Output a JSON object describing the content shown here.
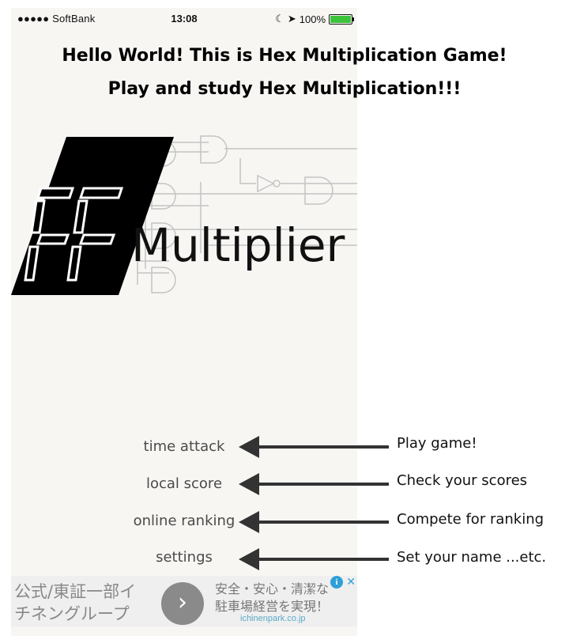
{
  "status_bar": {
    "carrier": "●●●●● SoftBank",
    "time": "13:08",
    "battery": "100%"
  },
  "headline": {
    "line1": "Hello World! This is Hex Multiplication Game!",
    "line2": "Play and study Hex Multiplication!!!"
  },
  "logo": {
    "digits": "FF",
    "word": "Multiplier"
  },
  "menu": [
    {
      "label": "time attack",
      "annotation": "Play game!"
    },
    {
      "label": "local score",
      "annotation": "Check your scores"
    },
    {
      "label": "online ranking",
      "annotation": "Compete for ranking"
    },
    {
      "label": "settings",
      "annotation": "Set your name ...etc."
    }
  ],
  "ad": {
    "left_text_1": "公式/東証一部イ",
    "left_text_2": "チネングループ",
    "right_text_1": "安全・安心・清潔な",
    "right_text_2": "駐車場経営を実現！",
    "url": "ichinenpark.co.jp",
    "button_glyph": "›",
    "info_glyph": "i",
    "close_glyph": "✕"
  },
  "colors": {
    "panel_bg": "#f7f6f3",
    "menu_text": "#4a4a4a",
    "arrow": "#333333",
    "battery_green": "#3bc43b"
  }
}
